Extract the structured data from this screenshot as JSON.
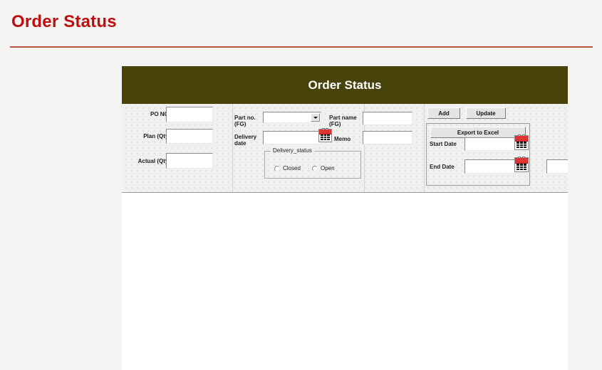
{
  "page": {
    "title": "Order Status"
  },
  "app": {
    "titlebar": "Order Status",
    "colors": {
      "titlebar_bg": "#47430a",
      "titlebar_text": "#ffffff",
      "page_title": "#bf0e0e",
      "rule": "#b5553f",
      "calendar_red": "#e03434"
    },
    "left_column": {
      "po_no_label": "PO NO.",
      "po_no_value": "",
      "plan_qty_label": "Plan (Qty)",
      "plan_qty_value": "",
      "actual_qty_label": "Actual (Qty)",
      "actual_qty_value": ""
    },
    "middle_column": {
      "part_no_label": "Part no.\n(FG)",
      "part_no_value": "",
      "delivery_date_label": "Delivery\ndate",
      "delivery_date_value": "",
      "delivery_status": {
        "legend": "Delivery_status",
        "options": [
          {
            "label": "Closed",
            "selected": false
          },
          {
            "label": "Open",
            "selected": false
          }
        ]
      }
    },
    "right_column": {
      "part_name_label": "Part name\n(FG)",
      "part_name_value": "",
      "memo_label": "Memo",
      "memo_value": ""
    },
    "actions": {
      "add_label": "Add",
      "update_label": "Update"
    },
    "export_panel": {
      "export_label": "Export to Excel",
      "start_date_label": "Start Date",
      "start_date_value": "",
      "end_date_label": "End  Date",
      "end_date_value": "",
      "extra_field_value": ""
    },
    "icons": {
      "calendar": "calendar-icon",
      "dropdown": "chevron-down-icon"
    }
  }
}
